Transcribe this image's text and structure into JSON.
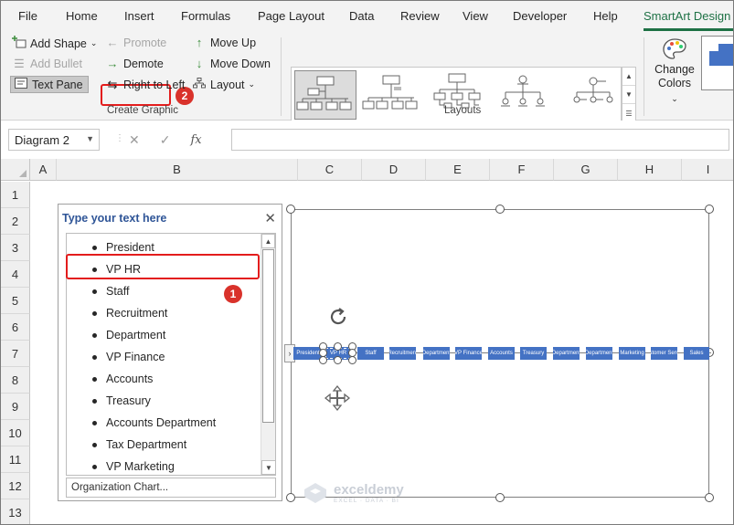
{
  "ribbon_tabs": [
    "File",
    "Home",
    "Insert",
    "Formulas",
    "Page Layout",
    "Data",
    "Review",
    "View",
    "Developer",
    "Help",
    "SmartArt Design"
  ],
  "active_tab": "SmartArt Design",
  "create_graphic": {
    "group_label": "Create Graphic",
    "add_shape": "Add Shape",
    "add_bullet": "Add Bullet",
    "text_pane": "Text Pane",
    "promote": "Promote",
    "demote": "Demote",
    "right_to_left": "Right to Left",
    "move_up": "Move Up",
    "move_down": "Move Down",
    "layout": "Layout"
  },
  "layouts": {
    "group_label": "Layouts"
  },
  "change_colors": {
    "line1": "Change",
    "line2": "Colors"
  },
  "annotations": {
    "step1": "1",
    "step2": "2"
  },
  "formula_bar": {
    "name_box": "Diagram 2",
    "fx": "fx",
    "value": ""
  },
  "columns": [
    "A",
    "B",
    "C",
    "D",
    "E",
    "F",
    "G",
    "H",
    "I"
  ],
  "rows": [
    "1",
    "2",
    "3",
    "4",
    "5",
    "6",
    "7",
    "8",
    "9",
    "10",
    "11",
    "12",
    "13"
  ],
  "text_pane": {
    "title": "Type your text here",
    "items": [
      "President",
      "VP HR",
      "Staff",
      "Recruitment",
      "Department",
      "VP Finance",
      "Accounts",
      "Treasury",
      "Accounts Department",
      "Tax Department",
      "VP Marketing"
    ],
    "footer": "Organization Chart..."
  },
  "diagram_nodes": [
    "President",
    "VP HR",
    "Staff",
    "Recruitment",
    "Department",
    "VP Finance",
    "Accounts",
    "Treasury",
    "Department",
    "Department",
    "Marketing",
    "Customer Service",
    "Sales"
  ],
  "watermark": {
    "name": "exceldemy",
    "tagline": "EXCEL · DATA · BI"
  },
  "colors": {
    "accent_green": "#1e7145",
    "node_blue": "#4472c4",
    "highlight_red": "#e31c1c",
    "title_blue": "#2f5597"
  }
}
